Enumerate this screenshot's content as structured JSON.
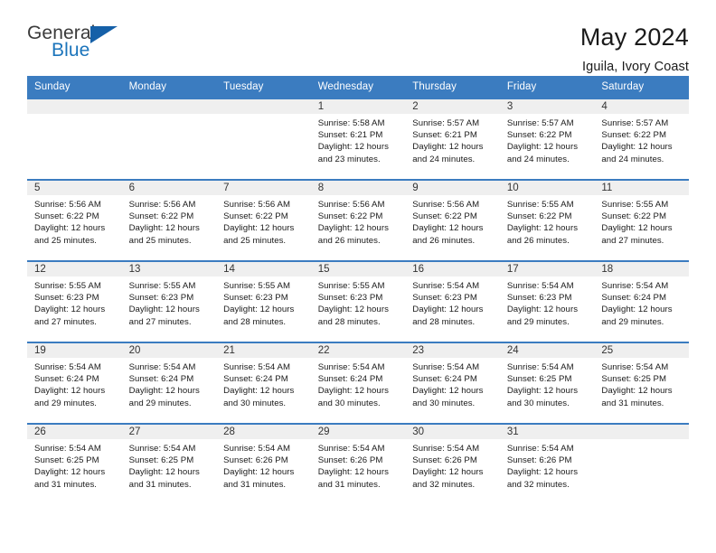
{
  "logo": {
    "text_top": "General",
    "text_bottom": "Blue",
    "accent_color": "#1560a8"
  },
  "header": {
    "title": "May 2024",
    "subtitle": "Iguila, Ivory Coast"
  },
  "theme": {
    "header_blue": "#3b7cc0",
    "daynum_band": "#efefef",
    "text": "#1a1a1a"
  },
  "calendar": {
    "weekday_headers": [
      "Sunday",
      "Monday",
      "Tuesday",
      "Wednesday",
      "Thursday",
      "Friday",
      "Saturday"
    ],
    "weeks": [
      [
        {
          "day": "",
          "sunrise": "",
          "sunset": "",
          "daylight1": "",
          "daylight2": ""
        },
        {
          "day": "",
          "sunrise": "",
          "sunset": "",
          "daylight1": "",
          "daylight2": ""
        },
        {
          "day": "",
          "sunrise": "",
          "sunset": "",
          "daylight1": "",
          "daylight2": ""
        },
        {
          "day": "1",
          "sunrise": "Sunrise: 5:58 AM",
          "sunset": "Sunset: 6:21 PM",
          "daylight1": "Daylight: 12 hours",
          "daylight2": "and 23 minutes."
        },
        {
          "day": "2",
          "sunrise": "Sunrise: 5:57 AM",
          "sunset": "Sunset: 6:21 PM",
          "daylight1": "Daylight: 12 hours",
          "daylight2": "and 24 minutes."
        },
        {
          "day": "3",
          "sunrise": "Sunrise: 5:57 AM",
          "sunset": "Sunset: 6:22 PM",
          "daylight1": "Daylight: 12 hours",
          "daylight2": "and 24 minutes."
        },
        {
          "day": "4",
          "sunrise": "Sunrise: 5:57 AM",
          "sunset": "Sunset: 6:22 PM",
          "daylight1": "Daylight: 12 hours",
          "daylight2": "and 24 minutes."
        }
      ],
      [
        {
          "day": "5",
          "sunrise": "Sunrise: 5:56 AM",
          "sunset": "Sunset: 6:22 PM",
          "daylight1": "Daylight: 12 hours",
          "daylight2": "and 25 minutes."
        },
        {
          "day": "6",
          "sunrise": "Sunrise: 5:56 AM",
          "sunset": "Sunset: 6:22 PM",
          "daylight1": "Daylight: 12 hours",
          "daylight2": "and 25 minutes."
        },
        {
          "day": "7",
          "sunrise": "Sunrise: 5:56 AM",
          "sunset": "Sunset: 6:22 PM",
          "daylight1": "Daylight: 12 hours",
          "daylight2": "and 25 minutes."
        },
        {
          "day": "8",
          "sunrise": "Sunrise: 5:56 AM",
          "sunset": "Sunset: 6:22 PM",
          "daylight1": "Daylight: 12 hours",
          "daylight2": "and 26 minutes."
        },
        {
          "day": "9",
          "sunrise": "Sunrise: 5:56 AM",
          "sunset": "Sunset: 6:22 PM",
          "daylight1": "Daylight: 12 hours",
          "daylight2": "and 26 minutes."
        },
        {
          "day": "10",
          "sunrise": "Sunrise: 5:55 AM",
          "sunset": "Sunset: 6:22 PM",
          "daylight1": "Daylight: 12 hours",
          "daylight2": "and 26 minutes."
        },
        {
          "day": "11",
          "sunrise": "Sunrise: 5:55 AM",
          "sunset": "Sunset: 6:22 PM",
          "daylight1": "Daylight: 12 hours",
          "daylight2": "and 27 minutes."
        }
      ],
      [
        {
          "day": "12",
          "sunrise": "Sunrise: 5:55 AM",
          "sunset": "Sunset: 6:23 PM",
          "daylight1": "Daylight: 12 hours",
          "daylight2": "and 27 minutes."
        },
        {
          "day": "13",
          "sunrise": "Sunrise: 5:55 AM",
          "sunset": "Sunset: 6:23 PM",
          "daylight1": "Daylight: 12 hours",
          "daylight2": "and 27 minutes."
        },
        {
          "day": "14",
          "sunrise": "Sunrise: 5:55 AM",
          "sunset": "Sunset: 6:23 PM",
          "daylight1": "Daylight: 12 hours",
          "daylight2": "and 28 minutes."
        },
        {
          "day": "15",
          "sunrise": "Sunrise: 5:55 AM",
          "sunset": "Sunset: 6:23 PM",
          "daylight1": "Daylight: 12 hours",
          "daylight2": "and 28 minutes."
        },
        {
          "day": "16",
          "sunrise": "Sunrise: 5:54 AM",
          "sunset": "Sunset: 6:23 PM",
          "daylight1": "Daylight: 12 hours",
          "daylight2": "and 28 minutes."
        },
        {
          "day": "17",
          "sunrise": "Sunrise: 5:54 AM",
          "sunset": "Sunset: 6:23 PM",
          "daylight1": "Daylight: 12 hours",
          "daylight2": "and 29 minutes."
        },
        {
          "day": "18",
          "sunrise": "Sunrise: 5:54 AM",
          "sunset": "Sunset: 6:24 PM",
          "daylight1": "Daylight: 12 hours",
          "daylight2": "and 29 minutes."
        }
      ],
      [
        {
          "day": "19",
          "sunrise": "Sunrise: 5:54 AM",
          "sunset": "Sunset: 6:24 PM",
          "daylight1": "Daylight: 12 hours",
          "daylight2": "and 29 minutes."
        },
        {
          "day": "20",
          "sunrise": "Sunrise: 5:54 AM",
          "sunset": "Sunset: 6:24 PM",
          "daylight1": "Daylight: 12 hours",
          "daylight2": "and 29 minutes."
        },
        {
          "day": "21",
          "sunrise": "Sunrise: 5:54 AM",
          "sunset": "Sunset: 6:24 PM",
          "daylight1": "Daylight: 12 hours",
          "daylight2": "and 30 minutes."
        },
        {
          "day": "22",
          "sunrise": "Sunrise: 5:54 AM",
          "sunset": "Sunset: 6:24 PM",
          "daylight1": "Daylight: 12 hours",
          "daylight2": "and 30 minutes."
        },
        {
          "day": "23",
          "sunrise": "Sunrise: 5:54 AM",
          "sunset": "Sunset: 6:24 PM",
          "daylight1": "Daylight: 12 hours",
          "daylight2": "and 30 minutes."
        },
        {
          "day": "24",
          "sunrise": "Sunrise: 5:54 AM",
          "sunset": "Sunset: 6:25 PM",
          "daylight1": "Daylight: 12 hours",
          "daylight2": "and 30 minutes."
        },
        {
          "day": "25",
          "sunrise": "Sunrise: 5:54 AM",
          "sunset": "Sunset: 6:25 PM",
          "daylight1": "Daylight: 12 hours",
          "daylight2": "and 31 minutes."
        }
      ],
      [
        {
          "day": "26",
          "sunrise": "Sunrise: 5:54 AM",
          "sunset": "Sunset: 6:25 PM",
          "daylight1": "Daylight: 12 hours",
          "daylight2": "and 31 minutes."
        },
        {
          "day": "27",
          "sunrise": "Sunrise: 5:54 AM",
          "sunset": "Sunset: 6:25 PM",
          "daylight1": "Daylight: 12 hours",
          "daylight2": "and 31 minutes."
        },
        {
          "day": "28",
          "sunrise": "Sunrise: 5:54 AM",
          "sunset": "Sunset: 6:26 PM",
          "daylight1": "Daylight: 12 hours",
          "daylight2": "and 31 minutes."
        },
        {
          "day": "29",
          "sunrise": "Sunrise: 5:54 AM",
          "sunset": "Sunset: 6:26 PM",
          "daylight1": "Daylight: 12 hours",
          "daylight2": "and 31 minutes."
        },
        {
          "day": "30",
          "sunrise": "Sunrise: 5:54 AM",
          "sunset": "Sunset: 6:26 PM",
          "daylight1": "Daylight: 12 hours",
          "daylight2": "and 32 minutes."
        },
        {
          "day": "31",
          "sunrise": "Sunrise: 5:54 AM",
          "sunset": "Sunset: 6:26 PM",
          "daylight1": "Daylight: 12 hours",
          "daylight2": "and 32 minutes."
        },
        {
          "day": "",
          "sunrise": "",
          "sunset": "",
          "daylight1": "",
          "daylight2": ""
        }
      ]
    ]
  }
}
